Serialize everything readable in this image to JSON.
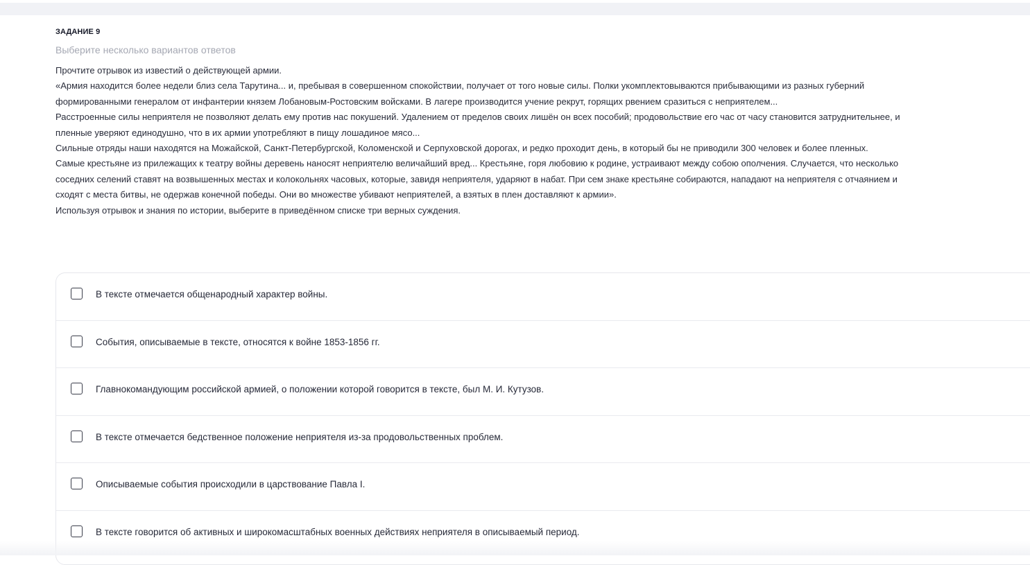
{
  "task": {
    "title": "ЗАДАНИЕ 9",
    "hint": "Выберите несколько вариантов ответов",
    "passage": [
      "Прочтите отрывок из известий о действующей армии.",
      "«Армия находится более недели близ села Тарутина... и, пребывая в совершенном спокойствии, получает от того новые силы. Полки укомплектовываются прибывающими из разных губерний",
      "формированными генералом от инфантерии князем Лобановым-Ростовским войсками. В лагере производится учение рекрут, горящих рвением сразиться с неприятелем...",
      "Расстроенные силы неприятеля не позволяют делать ему против нас покушений. Удалением от пределов своих лишён он всех пособий; продовольствие его час от часу становится затруднительнее, и",
      "пленные уверяют единодушно, что в их армии употребляют в пищу лошадиное мясо...",
      "Сильные отряды наши находятся на Можайской, Санкт-Петербургской, Коломенской и Серпуховской дорогах, и редко проходит день, в который бы не приводили 300 человек и более пленных.",
      "Самые крестьяне из прилежащих к театру войны деревень наносят неприятелю величайший вред... Крестьяне, горя любовию к родине, устраивают между собою ополчения. Случается, что несколько",
      "соседних селений ставят на возвышенных местах и колокольнях часовых, которые, завидя неприятеля, ударяют в набат. При сем знаке крестьяне собираются, нападают на неприятеля с отчаянием и",
      "сходят с места битвы, не одержав конечной победы. Они во множестве убивают неприятелей, а взятых в плен доставляют к армии».",
      "Используя отрывок и знания по истории, выберите в приведённом списке три верных суждения."
    ]
  },
  "options": [
    {
      "label": "В тексте отмечается общенародный характер войны.",
      "checked": false
    },
    {
      "label": "События, описываемые в тексте, относятся к войне 1853-1856 гг.",
      "checked": false
    },
    {
      "label": "Главнокомандующим российской армией, о положении которой говорится в тексте, был М. И. Кутузов.",
      "checked": false
    },
    {
      "label": "В тексте отмечается бедственное положение неприятеля из-за продовольственных проблем.",
      "checked": false
    },
    {
      "label": "Описываемые события происходили в царствование Павла I.",
      "checked": false
    },
    {
      "label": "В тексте говорится об активных и широкомасштабных военных действиях неприятеля в описываемый период.",
      "checked": false
    }
  ]
}
